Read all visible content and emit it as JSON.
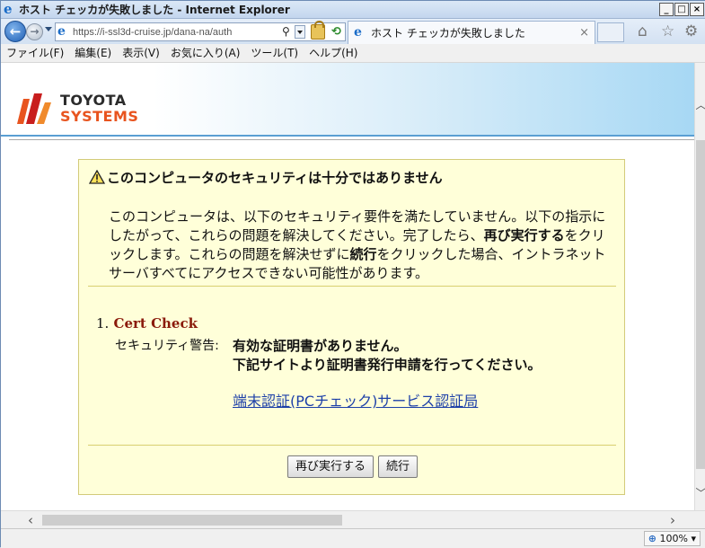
{
  "window": {
    "title": "ホスト チェッカが失敗しました - Internet Explorer",
    "controls": {
      "minimize": "_",
      "maximize": "□",
      "close": "×"
    }
  },
  "navbar": {
    "url": "https://i-ssl3d-cruise.jp/dana-na/auth",
    "tab_title": "ホスト チェッカが失敗しました",
    "tab_close": "×",
    "icons": [
      "back-icon",
      "forward-icon",
      "search-icon",
      "lock-icon",
      "refresh-icon",
      "home-icon",
      "star-icon",
      "gear-icon"
    ]
  },
  "menu": [
    "ファイル(F)",
    "編集(E)",
    "表示(V)",
    "お気に入り(A)",
    "ツール(T)",
    "ヘルプ(H)"
  ],
  "banner": {
    "logo_line1": "TOYOTA",
    "logo_line2": "SYSTEMS",
    "colors": {
      "logo_orange": "#e8541f",
      "logo_red": "#c81e1e",
      "logo_gray": "#2b2b2b"
    }
  },
  "panel": {
    "title": "このコンピュータのセキュリティは十分ではありません",
    "message_parts": [
      "このコンピュータは、以下のセキュリティ要件を満たしていません。以下の指示にしたがって、これらの問題を解決してください。完了したら、",
      "再び実行する",
      "をクリックします。これらの問題を解決せずに",
      "続行",
      "をクリックした場合、イントラネット サーバすべてにアクセスできない可能性があります。"
    ],
    "check": {
      "number": "1.",
      "name": "Cert Check",
      "warning_label": "セキュリティ警告:",
      "warning_line1": "有効な証明書がありません。",
      "warning_line2": "下記サイトより証明書発行申請を行ってください。",
      "link_text": "端末認証(PCチェック)サービス認証局"
    },
    "buttons": {
      "retry": "再び実行する",
      "continue": "続行"
    },
    "colors": {
      "background": "#ffffd9",
      "check_title": "#8a1a0a",
      "link": "#1c3fa8"
    }
  },
  "statusbar": {
    "zoom": "100%"
  }
}
